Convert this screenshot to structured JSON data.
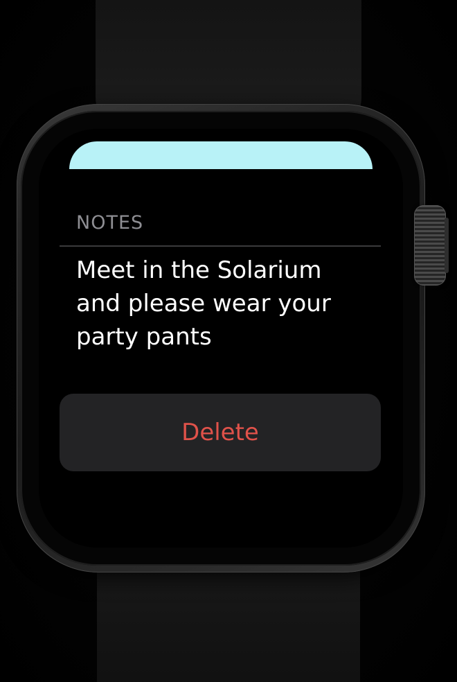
{
  "notes": {
    "section_label": "NOTES",
    "text": "Meet in the Solarium\nand please wear your\nparty pants"
  },
  "actions": {
    "delete_label": "Delete"
  },
  "colors": {
    "top_card": "#b8f2f7",
    "delete_text": "#e0524a",
    "button_bg": "#232325",
    "label_gray": "#8e8e93"
  }
}
